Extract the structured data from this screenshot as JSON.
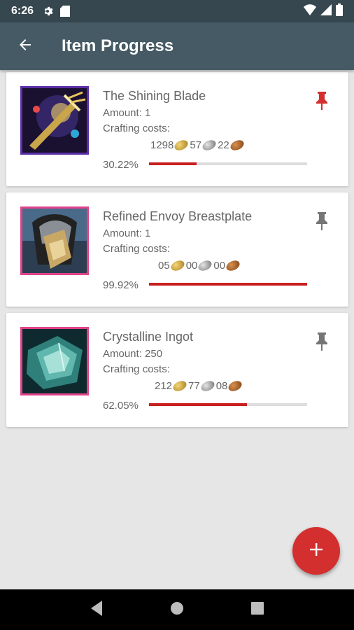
{
  "status_bar": {
    "time": "6:26"
  },
  "app_bar": {
    "title": "Item Progress"
  },
  "labels": {
    "crafting_costs": "Crafting costs:"
  },
  "items": [
    {
      "name": "The Shining Blade",
      "amount": "Amount: 1",
      "cost_gold": "1298",
      "cost_silver": "57",
      "cost_copper": "22",
      "percent": "30.22%",
      "progress": 0.3022,
      "pinned": true
    },
    {
      "name": "Refined Envoy Breastplate",
      "amount": "Amount: 1",
      "cost_gold": "05",
      "cost_silver": "00",
      "cost_copper": "00",
      "percent": "99.92%",
      "progress": 0.9992,
      "pinned": false
    },
    {
      "name": "Crystalline Ingot",
      "amount": "Amount: 250",
      "cost_gold": "212",
      "cost_silver": "77",
      "cost_copper": "08",
      "percent": "62.05%",
      "progress": 0.6205,
      "pinned": false
    }
  ],
  "colors": {
    "status_bar": "#37474f",
    "app_bar": "#455a64",
    "accent": "#d32f2f",
    "pin_active": "#d32f2f",
    "pin_inactive": "#757575"
  },
  "icons": {
    "back": "arrow-back-icon",
    "pin": "pin-icon",
    "add": "plus-icon",
    "settings": "gear-icon",
    "sd_card": "sd-card-icon",
    "wifi": "wifi-icon",
    "signal": "signal-icon",
    "battery": "battery-icon",
    "nav_back": "nav-back-icon",
    "nav_home": "nav-home-icon",
    "nav_recents": "nav-recents-icon"
  }
}
